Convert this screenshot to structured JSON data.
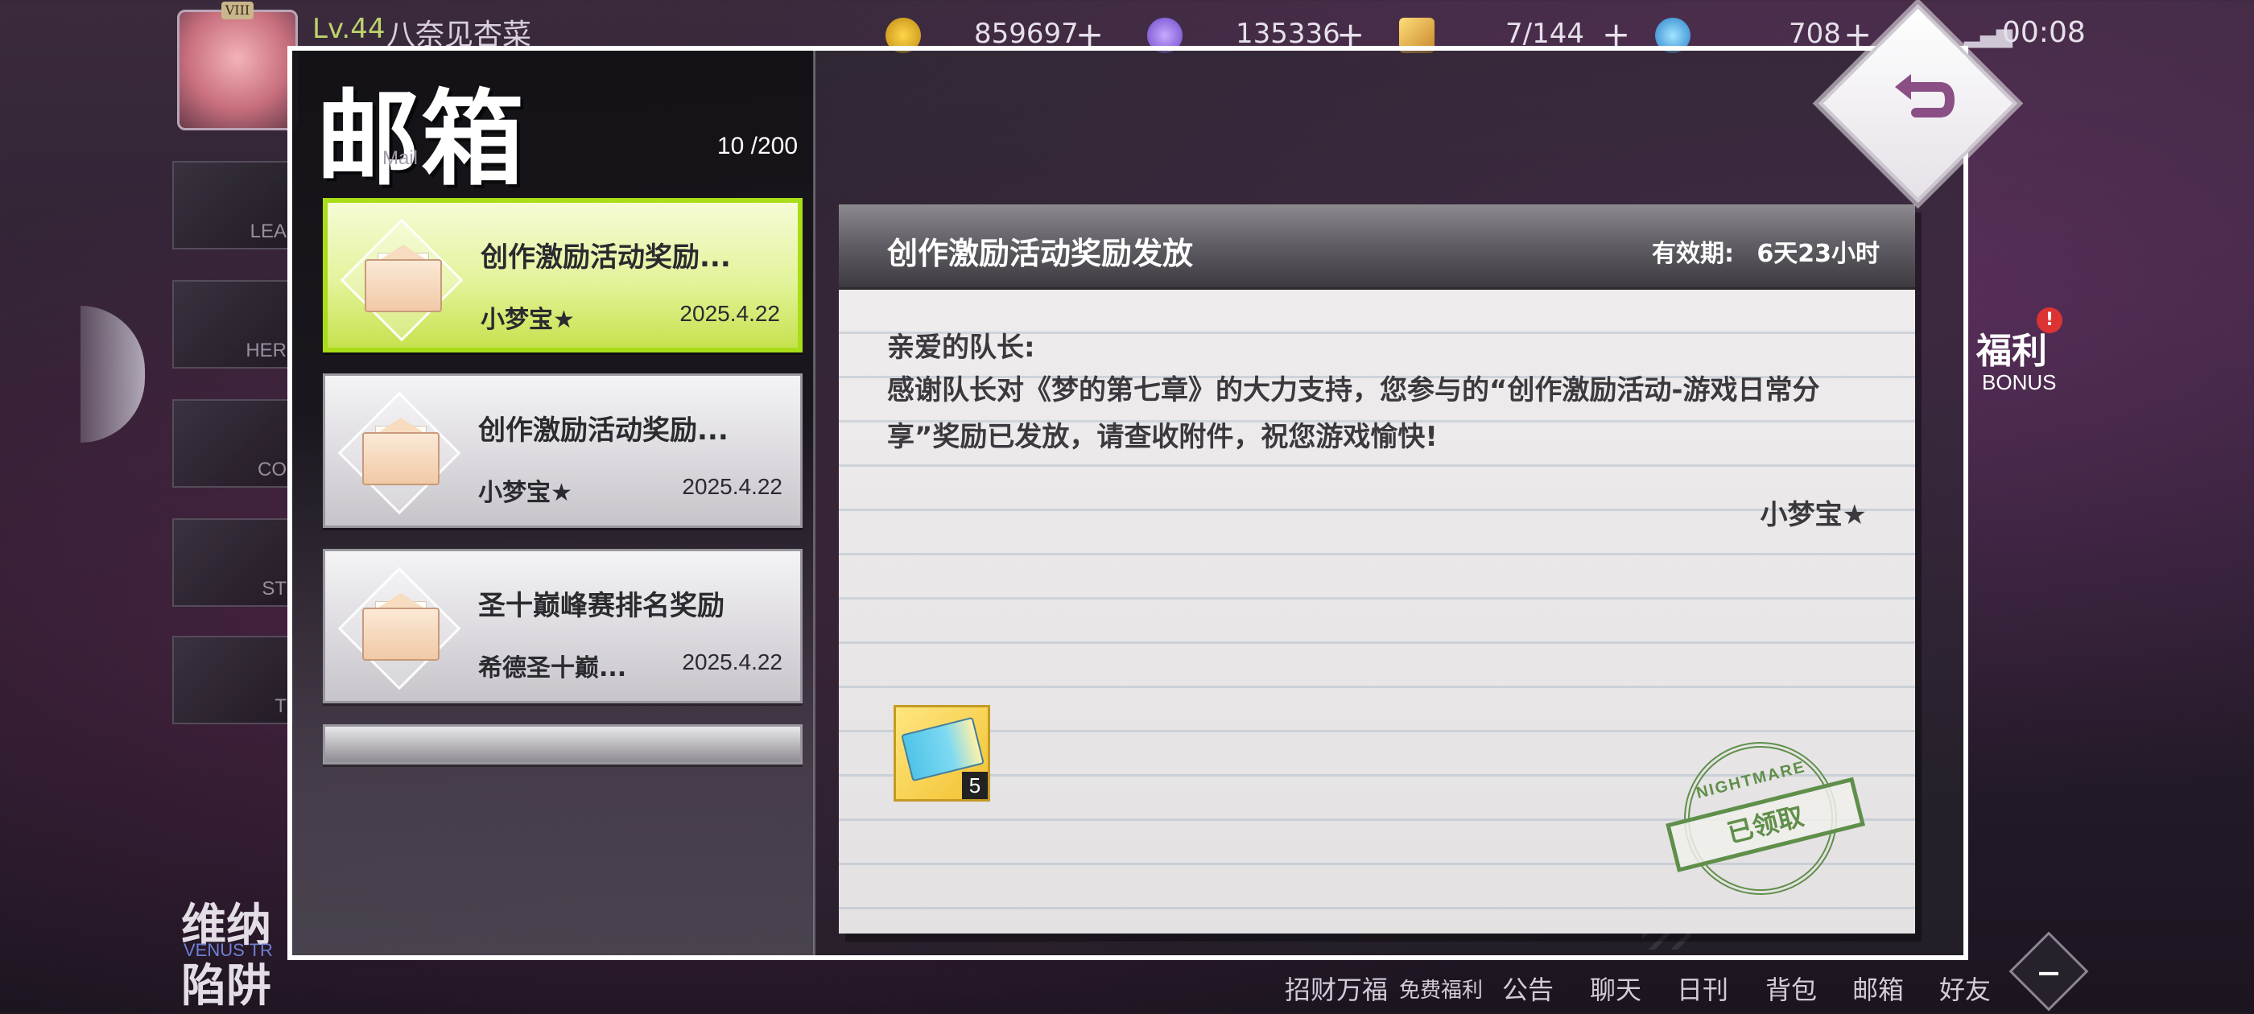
{
  "hud": {
    "avatar_rank": "VIII",
    "level": "Lv.44",
    "player_name": "八奈见杏菜",
    "gold": "859697",
    "butterfly": "135336",
    "stamina": "7/144",
    "diamond": "708",
    "time": "00:08"
  },
  "side_menu": [
    {
      "label": "LEA"
    },
    {
      "label": "HER"
    },
    {
      "label": "CO"
    },
    {
      "label": "ST"
    },
    {
      "label": "T"
    }
  ],
  "welfare": {
    "label": "福利",
    "sub": "BONUS",
    "badge": "!"
  },
  "bottom_nav": [
    "招财万福",
    "免费福利",
    "公告",
    "聊天",
    "日刊",
    "背包",
    "邮箱",
    "好友"
  ],
  "bottom_left": {
    "title1": "维纳",
    "sub": "VENUS TR",
    "title2": "陷阱"
  },
  "mailbox": {
    "title": "邮箱",
    "subtitle": "Mail",
    "count": "10 /200"
  },
  "mails": [
    {
      "title": "创作激励活动奖励...",
      "sender": "小梦宝★",
      "date": "2025.4.22",
      "selected": true
    },
    {
      "title": "创作激励活动奖励...",
      "sender": "小梦宝★",
      "date": "2025.4.22",
      "selected": false
    },
    {
      "title": "圣十巅峰赛排名奖励",
      "sender": "希德圣十巅...",
      "date": "2025.4.22",
      "selected": false
    }
  ],
  "detail": {
    "title": "创作激励活动奖励发放",
    "expiry_label": "有效期:",
    "expiry_value": "6天23小时",
    "salutation": "亲爱的队长:",
    "body": "感谢队长对《梦的第七章》的大力支持，您参与的“创作激励活动-游戏日常分享”奖励已发放，请查收附件，祝您游戏愉快!",
    "signature": "小梦宝★",
    "attachment": {
      "icon": "ticket-icon",
      "quantity": "5"
    },
    "stamp": {
      "top": "NIGHTMARE",
      "label": "已领取"
    }
  }
}
